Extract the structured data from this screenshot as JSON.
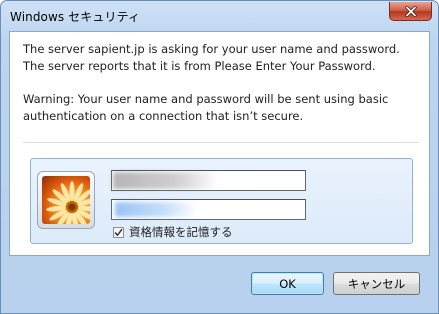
{
  "window": {
    "title": "Windows セキュリティ",
    "close_label": "Close"
  },
  "message": {
    "line1": "The server sapient.jp is asking for your user name and password.",
    "line2": "The server reports that it is from Please Enter Your Password.",
    "warning1": "Warning: Your user name and password will be sent using basic",
    "warning2": "authentication on a connection that isn’t secure."
  },
  "credentials": {
    "username_value": "",
    "password_value": "",
    "remember_label": "資格情報を記憶する",
    "remember_checked": true,
    "tile_image": "flower-user-picture"
  },
  "buttons": {
    "ok_label": "OK",
    "cancel_label": "キャンセル"
  },
  "colors": {
    "frame": "#bcd5f0",
    "panel": "#dceaf9",
    "close_button": "#c9472e",
    "default_button_border": "#3c7fb1"
  }
}
